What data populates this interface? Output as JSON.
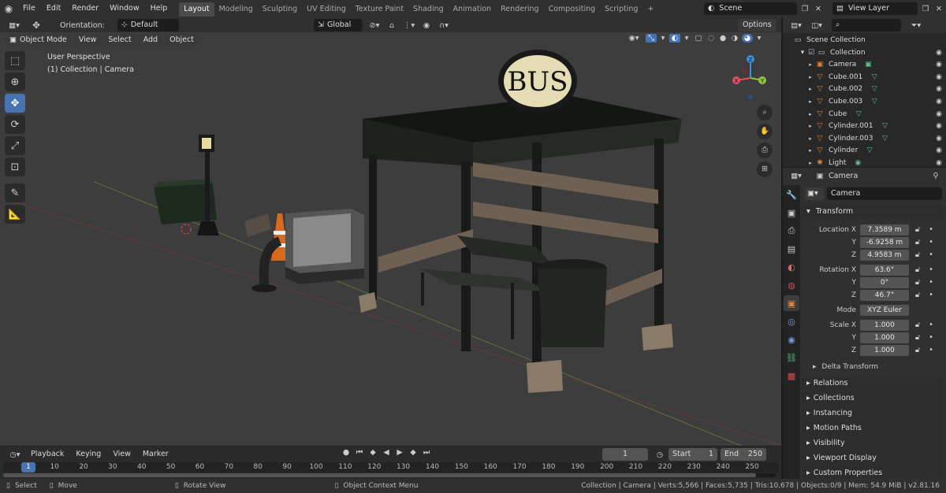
{
  "topbar": {
    "menus": [
      "File",
      "Edit",
      "Render",
      "Window",
      "Help"
    ],
    "workspaces": [
      "Layout",
      "Modeling",
      "Sculpting",
      "UV Editing",
      "Texture Paint",
      "Shading",
      "Animation",
      "Rendering",
      "Compositing",
      "Scripting"
    ],
    "add_tab": "+",
    "scene": "Scene",
    "view_layer": "View Layer"
  },
  "viewport_header": {
    "orientation_label": "Orientation:",
    "orientation_value": "Default",
    "mode": "Object Mode",
    "menus": [
      "View",
      "Select",
      "Add",
      "Object"
    ],
    "transform_space": "Global",
    "options": "Options"
  },
  "viewport": {
    "perspective": "User Perspective",
    "context": "(1) Collection | Camera",
    "sign_text": "BUS",
    "gizmo_axes": [
      "X",
      "Y",
      "Z"
    ]
  },
  "outliner": {
    "root": "Scene Collection",
    "collection": "Collection",
    "items": [
      "Camera",
      "Cube.001",
      "Cube.002",
      "Cube.003",
      "Cube",
      "Cylinder.001",
      "Cylinder.003",
      "Cylinder",
      "Light"
    ]
  },
  "properties": {
    "object_name": "Camera",
    "data_name": "Camera",
    "transform_header": "Transform",
    "location_label": "Location X",
    "location": [
      "7.3589 m",
      "-6.9258 m",
      "4.9583 m"
    ],
    "rotation_label": "Rotation X",
    "rotation": [
      "63.6°",
      "0°",
      "46.7°"
    ],
    "mode_label": "Mode",
    "mode_value": "XYZ Euler",
    "scale_label": "Scale X",
    "scale": [
      "1.000",
      "1.000",
      "1.000"
    ],
    "axis_y": "Y",
    "axis_z": "Z",
    "delta": "Delta Transform",
    "panels": [
      "Relations",
      "Collections",
      "Instancing",
      "Motion Paths",
      "Visibility",
      "Viewport Display",
      "Custom Properties"
    ]
  },
  "timeline": {
    "menus": [
      "Playback",
      "Keying",
      "View",
      "Marker"
    ],
    "current_frame": "1",
    "start_label": "Start",
    "start": "1",
    "end_label": "End",
    "end": "250",
    "ticks": [
      "1",
      "10",
      "20",
      "30",
      "40",
      "50",
      "60",
      "70",
      "80",
      "90",
      "100",
      "110",
      "120",
      "130",
      "140",
      "150",
      "160",
      "170",
      "180",
      "190",
      "200",
      "210",
      "220",
      "230",
      "240",
      "250"
    ]
  },
  "statusbar": {
    "select": "Select",
    "move": "Move",
    "rotate": "Rotate View",
    "context_menu": "Object Context Menu",
    "stats": "Collection | Camera | Verts:5,566 | Faces:5,735 | Tris:10,678 | Objects:0/9 | Mem: 54.9 MiB | v2.81.16"
  },
  "colors": {
    "accent": "#4772b3",
    "object_orange": "#e0843a",
    "mesh_green": "#5fbf8f",
    "axis_x": "#e05060",
    "axis_y": "#8cc63f",
    "axis_z": "#3a8fe0"
  }
}
